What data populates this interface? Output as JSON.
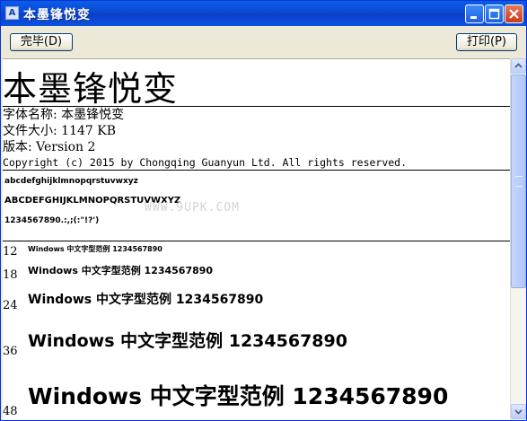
{
  "window": {
    "title": "本墨锋悦变",
    "icon": "font-file-icon"
  },
  "toolbar": {
    "done_label": "完毕(D)",
    "print_label": "打印(P)"
  },
  "preview": {
    "font_name_large": "本墨锋悦变",
    "info": {
      "font_name_line": "字体名称: 本墨锋悦变",
      "file_size_line": "文件大小: 1147 KB",
      "version_line": "版本: Version 2",
      "copyright_line": "Copyright (c) 2015 by Chongqing Guanyun Ltd. All rights reserved."
    },
    "charset": {
      "lowercase": "abcdefghijklmnopqrstuvwxyz",
      "uppercase": "ABCDEFGHIJKLMNOPQRSTUVWXYZ",
      "digits": "1234567890.:,;(:\"!?')"
    },
    "watermark": "WWW.9UPK.COM",
    "size_samples": [
      {
        "size": "12",
        "text": "Windows 中文字型范例 1234567890"
      },
      {
        "size": "18",
        "text": "Windows 中文字型范例 1234567890"
      },
      {
        "size": "24",
        "text": "Windows 中文字型范例 1234567890"
      },
      {
        "size": "36",
        "text": "Windows 中文字型范例 1234567890"
      },
      {
        "size": "48",
        "text": "Windows 中文字型范例 1234567890"
      }
    ]
  }
}
